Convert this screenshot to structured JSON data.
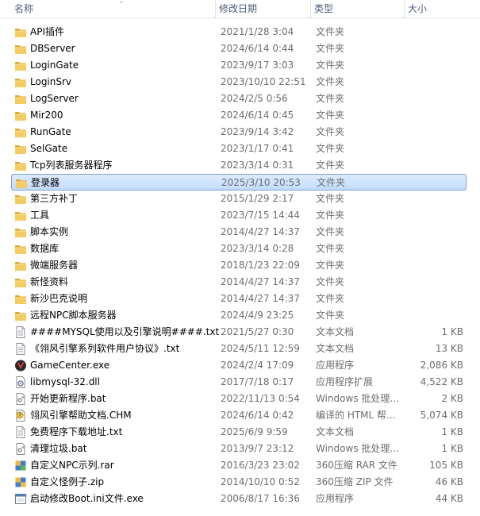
{
  "columns": {
    "name": "名称",
    "date": "修改日期",
    "type": "类型",
    "size": "大小"
  },
  "colors": {
    "folder": "#e8b94a",
    "selected": "#cce4fd",
    "header_text": "#4c607a"
  },
  "selected_index": 9,
  "files": [
    {
      "name": "API插件",
      "date": "2021/1/28 3:04",
      "type": "文件夹",
      "size": "",
      "icon": "folder-icon"
    },
    {
      "name": "DBServer",
      "date": "2024/6/14 0:44",
      "type": "文件夹",
      "size": "",
      "icon": "folder-icon"
    },
    {
      "name": "LoginGate",
      "date": "2023/9/17 3:03",
      "type": "文件夹",
      "size": "",
      "icon": "folder-icon"
    },
    {
      "name": "LoginSrv",
      "date": "2023/10/10 22:51",
      "type": "文件夹",
      "size": "",
      "icon": "folder-icon"
    },
    {
      "name": "LogServer",
      "date": "2024/2/5 0:56",
      "type": "文件夹",
      "size": "",
      "icon": "folder-icon"
    },
    {
      "name": "Mir200",
      "date": "2024/6/14 0:45",
      "type": "文件夹",
      "size": "",
      "icon": "folder-icon"
    },
    {
      "name": "RunGate",
      "date": "2023/9/14 3:42",
      "type": "文件夹",
      "size": "",
      "icon": "folder-icon"
    },
    {
      "name": "SelGate",
      "date": "2023/1/17 0:41",
      "type": "文件夹",
      "size": "",
      "icon": "folder-icon"
    },
    {
      "name": "Tcp列表服务器程序",
      "date": "2023/3/14 0:31",
      "type": "文件夹",
      "size": "",
      "icon": "folder-icon"
    },
    {
      "name": "登录器",
      "date": "2025/3/10 20:53",
      "type": "文件夹",
      "size": "",
      "icon": "folder-icon"
    },
    {
      "name": "第三方补丁",
      "date": "2015/1/29 2:17",
      "type": "文件夹",
      "size": "",
      "icon": "folder-icon"
    },
    {
      "name": "工具",
      "date": "2023/7/15 14:44",
      "type": "文件夹",
      "size": "",
      "icon": "folder-icon"
    },
    {
      "name": "脚本实例",
      "date": "2014/4/27 14:37",
      "type": "文件夹",
      "size": "",
      "icon": "folder-icon"
    },
    {
      "name": "数据库",
      "date": "2023/3/14 0:28",
      "type": "文件夹",
      "size": "",
      "icon": "folder-icon"
    },
    {
      "name": "微端服务器",
      "date": "2018/1/23 22:09",
      "type": "文件夹",
      "size": "",
      "icon": "folder-icon"
    },
    {
      "name": "新怪资料",
      "date": "2014/4/27 14:37",
      "type": "文件夹",
      "size": "",
      "icon": "folder-icon"
    },
    {
      "name": "新沙巴克说明",
      "date": "2014/4/27 14:37",
      "type": "文件夹",
      "size": "",
      "icon": "folder-icon"
    },
    {
      "name": "远程NPC脚本服务器",
      "date": "2024/4/9 23:25",
      "type": "文件夹",
      "size": "",
      "icon": "folder-icon"
    },
    {
      "name": "####MYSQL使用以及引擎说明####.txt",
      "date": "2021/5/27 0:30",
      "type": "文本文档",
      "size": "1 KB",
      "icon": "text-file-icon"
    },
    {
      "name": "《翎风引擎系列软件用户协议》.txt",
      "date": "2024/5/11 12:59",
      "type": "文本文档",
      "size": "13 KB",
      "icon": "text-file-icon"
    },
    {
      "name": "GameCenter.exe",
      "date": "2024/2/4 17:09",
      "type": "应用程序",
      "size": "2,086 KB",
      "icon": "gamecenter-app-icon"
    },
    {
      "name": "libmysql-32.dll",
      "date": "2017/7/18 0:17",
      "type": "应用程序扩展",
      "size": "4,522 KB",
      "icon": "dll-file-icon"
    },
    {
      "name": "开始更新程序.bat",
      "date": "2022/11/13 0:54",
      "type": "Windows 批处理...",
      "size": "2 KB",
      "icon": "batch-file-icon"
    },
    {
      "name": "翎风引擎帮助文档.CHM",
      "date": "2024/6/14 0:42",
      "type": "编译的 HTML 帮...",
      "size": "5,074 KB",
      "icon": "chm-help-icon"
    },
    {
      "name": "免费程序下载地址.txt",
      "date": "2025/6/9 9:59",
      "type": "文本文档",
      "size": "1 KB",
      "icon": "text-file-icon"
    },
    {
      "name": "清理垃圾.bat",
      "date": "2013/9/7 23:12",
      "type": "Windows 批处理...",
      "size": "1 KB",
      "icon": "batch-file-icon"
    },
    {
      "name": "自定义NPC示列.rar",
      "date": "2016/3/23 23:02",
      "type": "360压缩 RAR 文件",
      "size": "105 KB",
      "icon": "rar-archive-icon"
    },
    {
      "name": "自定义怪例子.zip",
      "date": "2014/10/10 0:52",
      "type": "360压缩 ZIP 文件",
      "size": "46 KB",
      "icon": "zip-archive-icon"
    },
    {
      "name": "启动修改Boot.ini文件.exe",
      "date": "2006/8/17 16:36",
      "type": "应用程序",
      "size": "44 KB",
      "icon": "exe-app-icon"
    }
  ]
}
